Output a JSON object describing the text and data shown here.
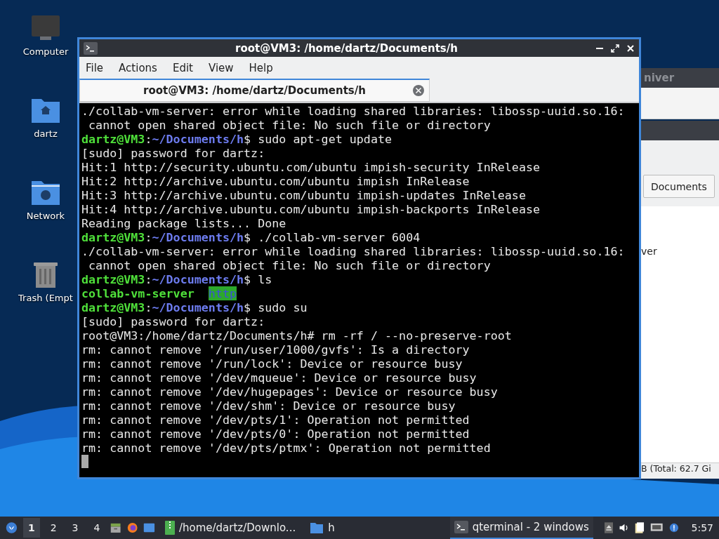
{
  "desktop_icons": [
    {
      "kind": "computer",
      "label": "Computer"
    },
    {
      "kind": "home",
      "label": "dartz"
    },
    {
      "kind": "network",
      "label": "Network"
    },
    {
      "kind": "trash",
      "label": "Trash (Empt"
    }
  ],
  "background_windows": [
    {
      "title": "niver"
    },
    {
      "button": "Documents",
      "text": "ver",
      "status": "B (Total: 62.7 Gi"
    }
  ],
  "terminal": {
    "title": "root@VM3: /home/dartz/Documents/h",
    "menu": [
      "File",
      "Actions",
      "Edit",
      "View",
      "Help"
    ],
    "tabs": [
      {
        "label": "root@VM3: /home/dartz/Documents/h",
        "selected": true
      }
    ],
    "lines": [
      [
        {
          "kind": "plain",
          "text": "./collab-vm-server: error while loading shared libraries: libossp-uuid.so.16:"
        }
      ],
      [
        {
          "kind": "plain",
          "text": " cannot open shared object file: No such file or directory"
        }
      ],
      [
        {
          "kind": "user",
          "text": "dartz@VM3"
        },
        {
          "kind": "plain",
          "text": ":"
        },
        {
          "kind": "path",
          "text": "~/Documents/h"
        },
        {
          "kind": "plain",
          "text": "$ sudo apt-get update"
        }
      ],
      [
        {
          "kind": "plain",
          "text": "[sudo] password for dartz:"
        }
      ],
      [
        {
          "kind": "plain",
          "text": "Hit:1 http://security.ubuntu.com/ubuntu impish-security InRelease"
        }
      ],
      [
        {
          "kind": "plain",
          "text": "Hit:2 http://archive.ubuntu.com/ubuntu impish InRelease"
        }
      ],
      [
        {
          "kind": "plain",
          "text": "Hit:3 http://archive.ubuntu.com/ubuntu impish-updates InRelease"
        }
      ],
      [
        {
          "kind": "plain",
          "text": "Hit:4 http://archive.ubuntu.com/ubuntu impish-backports InRelease"
        }
      ],
      [
        {
          "kind": "plain",
          "text": "Reading package lists... Done"
        }
      ],
      [
        {
          "kind": "user",
          "text": "dartz@VM3"
        },
        {
          "kind": "plain",
          "text": ":"
        },
        {
          "kind": "path",
          "text": "~/Documents/h"
        },
        {
          "kind": "plain",
          "text": "$ ./collab-vm-server 6004"
        }
      ],
      [
        {
          "kind": "plain",
          "text": "./collab-vm-server: error while loading shared libraries: libossp-uuid.so.16:"
        }
      ],
      [
        {
          "kind": "plain",
          "text": " cannot open shared object file: No such file or directory"
        }
      ],
      [
        {
          "kind": "user",
          "text": "dartz@VM3"
        },
        {
          "kind": "plain",
          "text": ":"
        },
        {
          "kind": "path",
          "text": "~/Documents/h"
        },
        {
          "kind": "plain",
          "text": "$ ls"
        }
      ],
      [
        {
          "kind": "exec",
          "text": "collab-vm-server"
        },
        {
          "kind": "dir",
          "text": "http"
        }
      ],
      [
        {
          "kind": "user",
          "text": "dartz@VM3"
        },
        {
          "kind": "plain",
          "text": ":"
        },
        {
          "kind": "path",
          "text": "~/Documents/h"
        },
        {
          "kind": "plain",
          "text": "$ sudo su"
        }
      ],
      [
        {
          "kind": "plain",
          "text": "[sudo] password for dartz:"
        }
      ],
      [
        {
          "kind": "plain",
          "text": "root@VM3:/home/dartz/Documents/h# rm -rf / --no-preserve-root"
        }
      ],
      [
        {
          "kind": "plain",
          "text": "rm: cannot remove '/run/user/1000/gvfs': Is a directory"
        }
      ],
      [
        {
          "kind": "plain",
          "text": "rm: cannot remove '/run/lock': Device or resource busy"
        }
      ],
      [
        {
          "kind": "plain",
          "text": "rm: cannot remove '/dev/mqueue': Device or resource busy"
        }
      ],
      [
        {
          "kind": "plain",
          "text": "rm: cannot remove '/dev/hugepages': Device or resource busy"
        }
      ],
      [
        {
          "kind": "plain",
          "text": "rm: cannot remove '/dev/shm': Device or resource busy"
        }
      ],
      [
        {
          "kind": "plain",
          "text": "rm: cannot remove '/dev/pts/1': Operation not permitted"
        }
      ],
      [
        {
          "kind": "plain",
          "text": "rm: cannot remove '/dev/pts/0': Operation not permitted"
        }
      ],
      [
        {
          "kind": "plain",
          "text": "rm: cannot remove '/dev/pts/ptmx': Operation not permitted"
        }
      ]
    ]
  },
  "taskbar": {
    "workspaces": [
      {
        "label": "1",
        "selected": true
      },
      {
        "label": "2",
        "selected": false
      },
      {
        "label": "3",
        "selected": false
      },
      {
        "label": "4",
        "selected": false
      }
    ],
    "tasks": [
      {
        "kind": "archive",
        "label": "/home/dartz/Downlo...",
        "selected": false
      },
      {
        "kind": "folder",
        "label": "h",
        "selected": false
      },
      {
        "kind": "terminal",
        "label": "qterminal - 2 windows",
        "selected": true
      }
    ],
    "clock": "5:57"
  }
}
